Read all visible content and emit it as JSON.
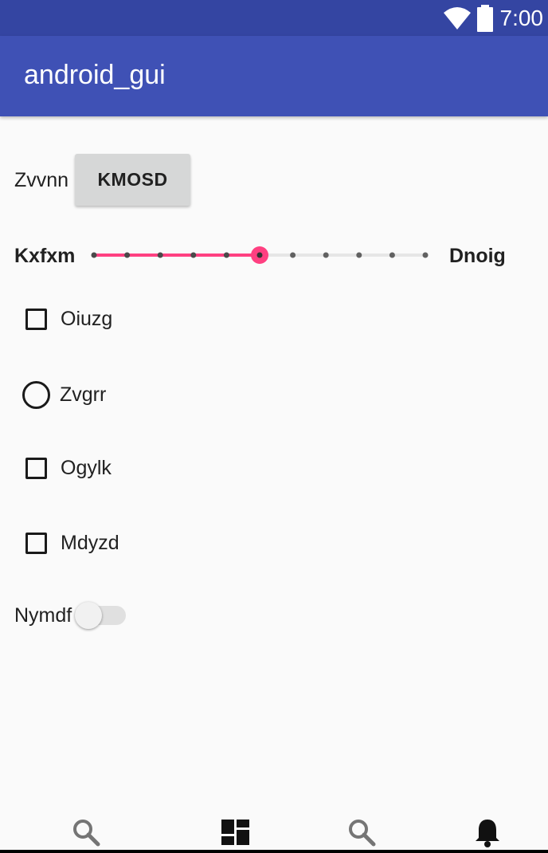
{
  "status_bar": {
    "time": "7:00",
    "icons": [
      "wifi-icon",
      "battery-icon"
    ]
  },
  "app_bar": {
    "title": "android_gui"
  },
  "form": {
    "button_row": {
      "label": "Zvvnn",
      "button_label": "KMOSD"
    },
    "slider_row": {
      "left_label": "Kxfxm",
      "right_label": "Dnoig",
      "ticks": 11,
      "selected_index": 5
    },
    "options": [
      {
        "type": "checkbox",
        "label": "Oiuzg",
        "checked": false
      },
      {
        "type": "radio",
        "label": "Zvgrr",
        "checked": false
      },
      {
        "type": "checkbox",
        "label": "Ogylk",
        "checked": false
      },
      {
        "type": "checkbox",
        "label": "Mdyzd",
        "checked": false
      }
    ],
    "switch_row": {
      "label": "Nymdf",
      "on": false
    }
  },
  "bottom_nav": {
    "items": [
      "search-icon",
      "dashboard-icon",
      "search-icon",
      "notifications-icon"
    ]
  },
  "colors": {
    "status_bar": "#3445a2",
    "app_bar": "#3f51b5",
    "accent": "#ff4081",
    "background": "#fafafa"
  }
}
